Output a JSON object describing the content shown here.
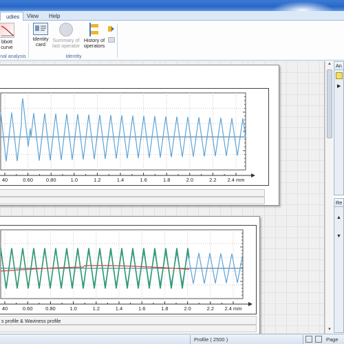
{
  "titlebar": {
    "glow": true
  },
  "tabs": [
    {
      "label": "udies",
      "active": true
    },
    {
      "label": "View",
      "active": false
    },
    {
      "label": "Help",
      "active": false
    }
  ],
  "ribbon": {
    "abbott_button": {
      "line1": "bbott",
      "line2": "curve"
    },
    "group_functional_label": "nal analysis",
    "identity_card_button": {
      "line1": "Identity",
      "line2": "card"
    },
    "summary_button": {
      "line1": "Summary of",
      "line2": "last operator",
      "disabled": true
    },
    "history_button": {
      "line1": "History of",
      "line2": "operators"
    },
    "group_identity_label": "Identity"
  },
  "plot1": {
    "x_ticks": [
      "40",
      "0.60",
      "0.80",
      "1.0",
      "1.2",
      "1.4",
      "1.6",
      "1.8",
      "2.0",
      "2.2",
      "2.4 mm"
    ]
  },
  "plot2": {
    "x_ticks": [
      "40",
      "0.60",
      "0.80",
      "1.0",
      "1.2",
      "1.4",
      "1.6",
      "1.8",
      "2.0",
      "2.2",
      "2.4 mm"
    ],
    "caption": "s profile & Waviness profile"
  },
  "right_panel_top": {
    "header": "An"
  },
  "right_panel_bottom": {
    "header": "Re"
  },
  "statusbar": {
    "profile": "Profile ( 2500 )",
    "page": "Page"
  },
  "colors": {
    "profile_line": "#5fa3d6",
    "roughness_line": "#2e9a6e",
    "waviness_line": "#c4453f",
    "mean_line": "#2b6a8f"
  },
  "icons": [
    "abbott-curve-icon",
    "identity-card-icon",
    "summary-operator-icon",
    "history-operators-icon",
    "export-arrow-icon",
    "overflow-icon"
  ]
}
